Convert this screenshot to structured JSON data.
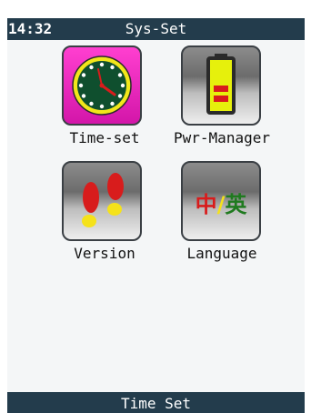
{
  "statusbar": {
    "time": "14:32",
    "title": "Sys-Set"
  },
  "apps": [
    {
      "label": "Time-set",
      "icon": "clock-icon"
    },
    {
      "label": "Pwr-Manager",
      "icon": "battery-icon"
    },
    {
      "label": "Version",
      "icon": "footprints-icon"
    },
    {
      "label": "Language",
      "icon": "language-icon",
      "glyph_left": "中",
      "glyph_sep": "/",
      "glyph_right": "英"
    }
  ],
  "bottombar": {
    "label": "Time Set"
  },
  "colors": {
    "bar": "#233c4c",
    "time_tile": "#ff3fd0",
    "clock_face": "#0f4f2e",
    "clock_ring": "#f2e61a",
    "footprint_red": "#d81c1c",
    "footprint_yellow": "#f5e21a"
  }
}
